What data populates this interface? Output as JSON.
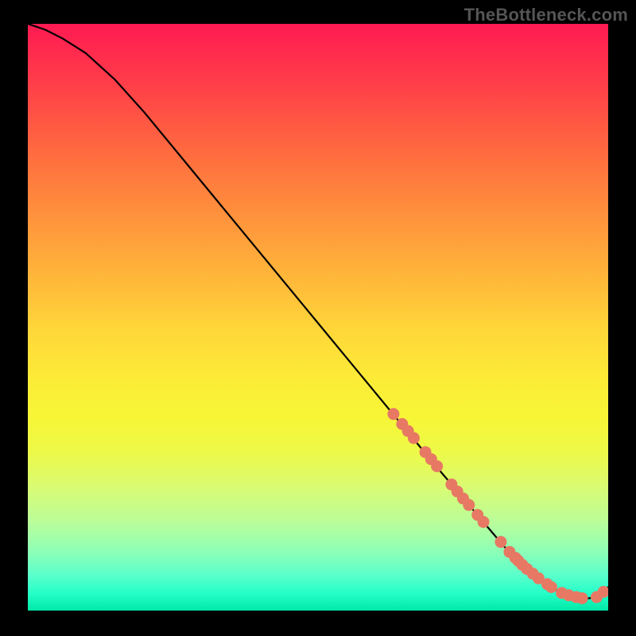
{
  "attribution": {
    "text": "TheBottleneck.com"
  },
  "colors": {
    "page_bg": "#000000",
    "attribution": "#555555",
    "curve": "#000000",
    "marker_fill": "#e77964",
    "marker_stroke": "#c9503f"
  },
  "chart_data": {
    "type": "line",
    "title": "",
    "xlabel": "",
    "ylabel": "",
    "xlim": [
      0,
      100
    ],
    "ylim": [
      0,
      100
    ],
    "grid": false,
    "series": [
      {
        "name": "curve",
        "x": [
          0,
          3,
          6,
          10,
          15,
          20,
          25,
          30,
          35,
          40,
          45,
          50,
          55,
          60,
          65,
          70,
          73,
          76,
          79,
          82,
          85,
          88,
          91,
          94,
          96,
          98,
          100
        ],
        "y": [
          100,
          99,
          97.5,
          95,
          90.5,
          85,
          79,
          73,
          67,
          61,
          55,
          49,
          43,
          37,
          31,
          25,
          21.5,
          18,
          14.5,
          11,
          8,
          5.5,
          3.5,
          2.3,
          2.0,
          2.3,
          4.0
        ]
      }
    ],
    "markers": {
      "name": "highlight-points",
      "x": [
        63,
        64.5,
        65.5,
        66.5,
        68.5,
        69.5,
        70.5,
        73,
        74,
        75,
        76,
        77.5,
        78.5,
        81.5,
        83,
        84,
        84.5,
        85.2,
        86,
        87,
        88,
        89.5,
        90.2,
        92,
        93.2,
        94.5,
        95.5,
        98,
        99.2
      ],
      "y": [
        33.5,
        31.8,
        30.6,
        29.4,
        27,
        25.8,
        24.6,
        21.5,
        20.3,
        19.1,
        18,
        16.3,
        15.1,
        11.7,
        10,
        9,
        8.5,
        7.8,
        7.1,
        6.3,
        5.5,
        4.5,
        4.0,
        3.0,
        2.6,
        2.3,
        2.1,
        2.3,
        3.2
      ]
    }
  }
}
